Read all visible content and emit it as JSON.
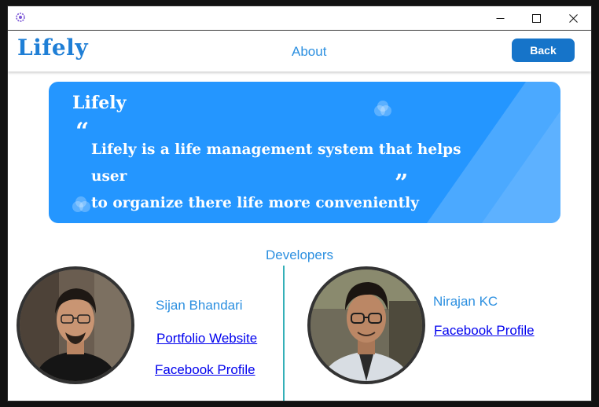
{
  "window": {
    "icon": "app-gear-icon",
    "controls": [
      "minimize-icon",
      "maximize-icon",
      "close-icon"
    ]
  },
  "header": {
    "logo": "Lifely",
    "nav_about": "About",
    "back_label": "Back"
  },
  "banner": {
    "title": "Lifely",
    "quote_open": "“",
    "quote_close": "”",
    "line1": "Lifely is a life management system that helps user",
    "line2": "to organize there life more conveniently"
  },
  "developers": {
    "title": "Developers",
    "list": [
      {
        "name": "Sijan Bhandari",
        "links": [
          "Portfolio Website",
          "Facebook Profile"
        ]
      },
      {
        "name": "Nirajan KC",
        "links": [
          "Facebook Profile"
        ]
      }
    ]
  },
  "colors": {
    "accent": "#2b8fe0",
    "banner": "#2496ff",
    "back_button": "#1674c9",
    "link": "#0000ee",
    "divider": "#35b0b8"
  }
}
